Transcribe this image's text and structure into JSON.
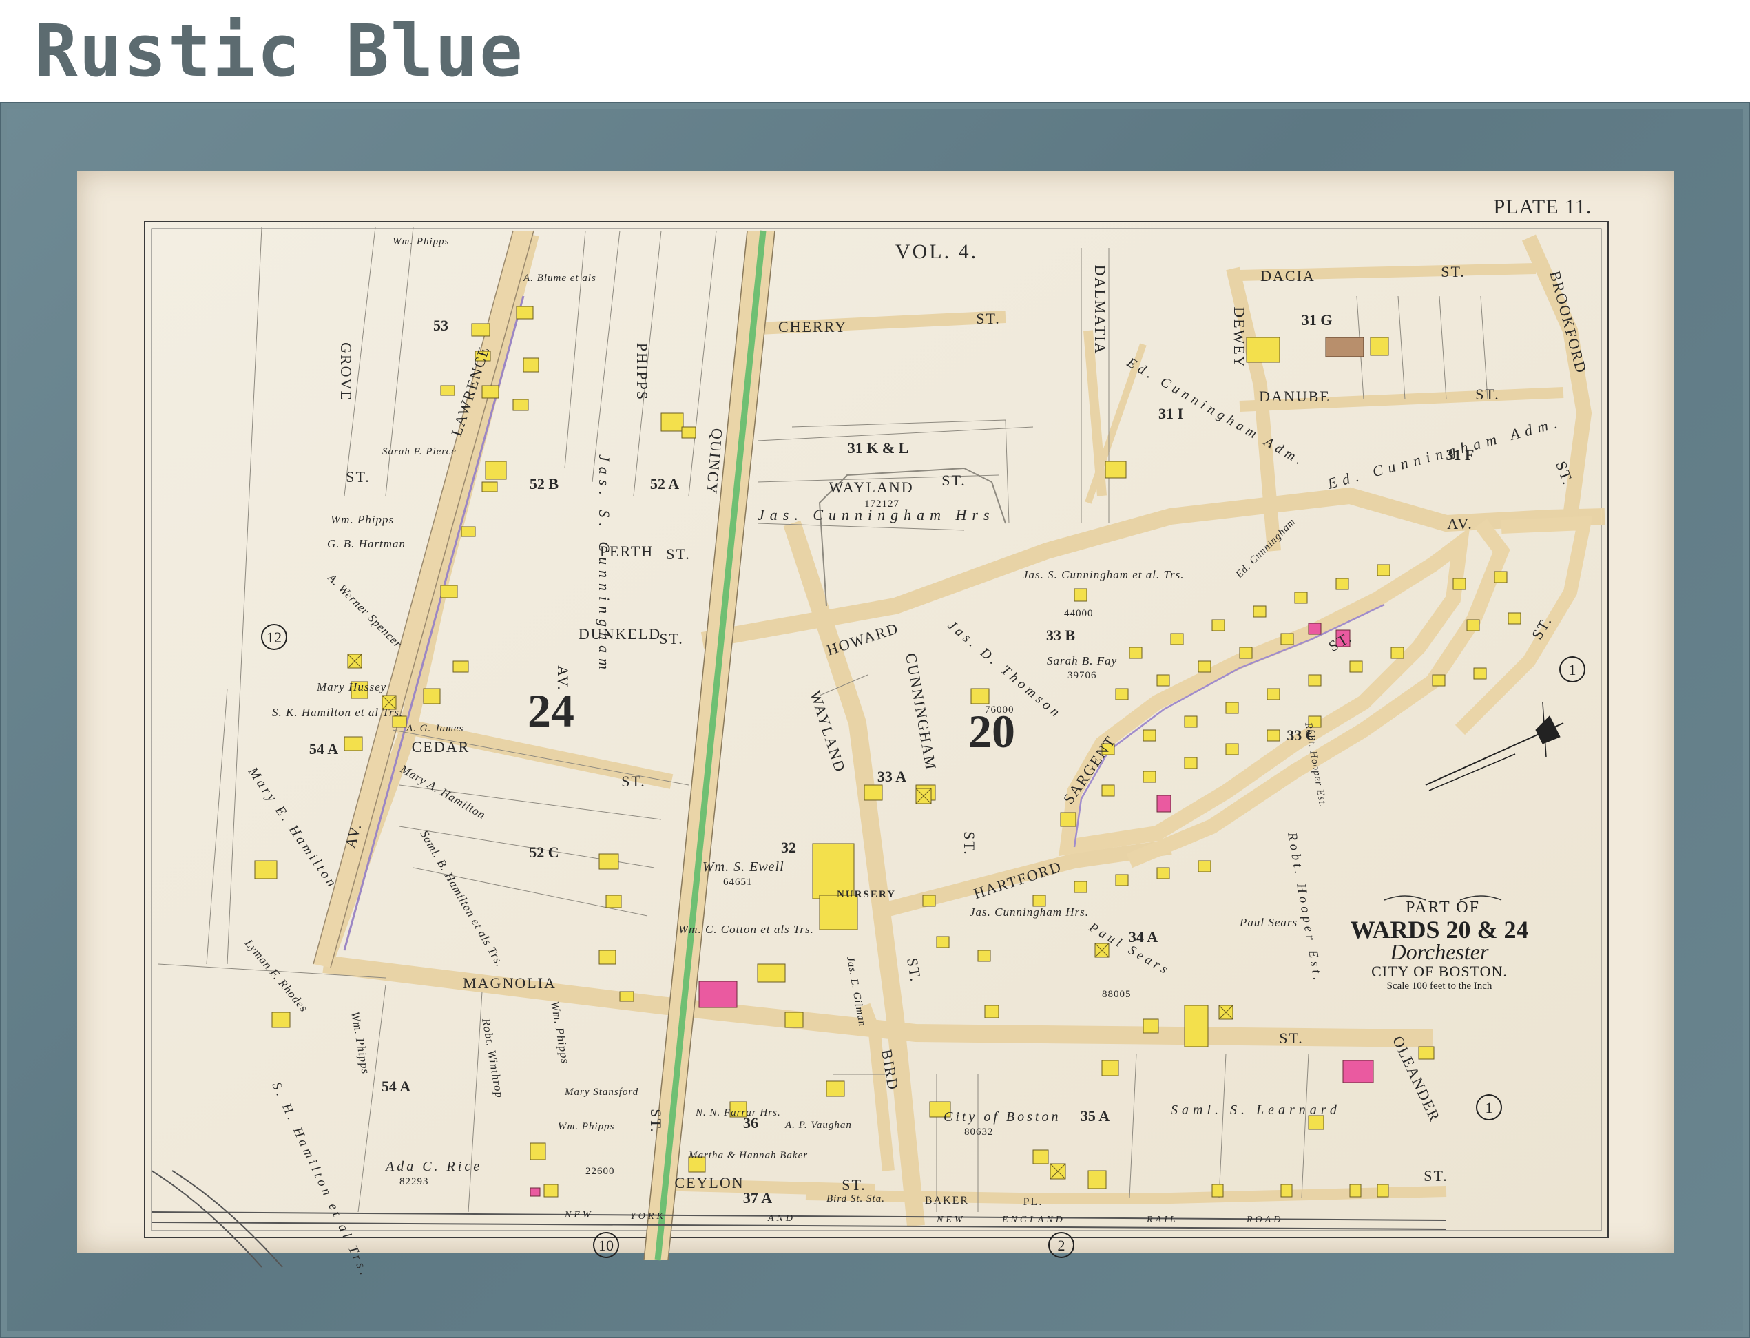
{
  "header": {
    "title": "Rustic Blue"
  },
  "map": {
    "plate": "PLATE 11.",
    "volume": "VOL. 4.",
    "cartouche": {
      "line1": "PART OF",
      "line2": "WARDS 20 & 24",
      "line3": "Dorchester",
      "line4": "CITY OF BOSTON.",
      "line5": "Scale 100 feet to the Inch"
    },
    "wards": {
      "left": "24",
      "right": "20"
    },
    "streets": {
      "lawrence": "LAWRENCE",
      "grove": "GROVE",
      "phipps": "PHIPPS",
      "quincy": "QUINCY",
      "cherry": "CHERRY",
      "cherry_st": "ST.",
      "dalmatia": "DALMATIA",
      "dewey": "DEWEY",
      "dacia": "DACIA",
      "dacia_st": "ST.",
      "brookford": "BROOKFORD",
      "danube": "DANUBE",
      "danube_st": "ST.",
      "wayland_top": "WAYLAND",
      "wayland_top_st": "ST.",
      "perth": "PERTH",
      "perth_st": "ST.",
      "howard": "HOWARD",
      "dunkeld": "DUNKELD",
      "dunkeld_st": "ST.",
      "cedar": "CEDAR",
      "cedar_st": "ST.",
      "wayland": "WAYLAND",
      "cunningham": "CUNNINGHAM",
      "sargent": "SARGENT",
      "sargent_st": "ST.",
      "hartford": "HARTFORD",
      "magnolia": "MAGNOLIA",
      "bird": "BIRD",
      "ceylon": "CEYLON",
      "ceylon_st": "ST.",
      "baker": "BAKER",
      "baker_pl": "PL.",
      "oleander": "OLEANDER",
      "oleander_st": "ST.",
      "av_left": "AV.",
      "av_mid": "AV.",
      "av_top": "AV.",
      "st_bottom": "ST.",
      "st_quincy": "ST.",
      "st_right": "ST.",
      "st_east": "ST.",
      "st_right2": "ST.",
      "grove_st": "ST.",
      "st_hartford": "ST.",
      "railroad": [
        "NEW",
        "YORK",
        "AND",
        "NEW",
        "ENGLAND",
        "RAIL",
        "ROAD"
      ]
    },
    "blocks": [
      "53",
      "52 B",
      "52 A",
      "31 K & L",
      "31 I",
      "31 F",
      "31 G",
      "33 B",
      "33 A",
      "32",
      "33 C",
      "52 C",
      "54 A",
      "54 A",
      "36",
      "35 A",
      "34 A",
      "37 A"
    ],
    "circles": [
      "12",
      "1",
      "1",
      "10",
      "2"
    ],
    "owners": [
      "Jas. Cunningham Hrs",
      "Jas. S. Cunningham",
      "Ed. Cunningham Adm.",
      "Ed. Cunningham Adm.",
      "Jas. S. Cunningham et al. Trs.",
      "Jas. D. Thomson",
      "Sarah B. Fay",
      "Wm. Phipps",
      "G. B. Hartman",
      "A. Werner Spencer",
      "Mary Hussey",
      "S. K. Hamilton et al Trs.",
      "Mary E. Hamilton",
      "Lyman F. Rhodes",
      "S. H. Hamilton et al Trs.",
      "Mary A. Hamilton",
      "Saml. B. Hamilton et als Trs.",
      "Wm. S. Ewell",
      "Wm. C. Cotton et als Trs.",
      "Wm. Phipps",
      "Robt. Winthrop",
      "Ada C. Rice",
      "Wm. Phipps",
      "Martha & Hannah Baker",
      "City of Boston",
      "Saml. S. Learnard",
      "Robt. Hooper Est.",
      "Paul Sears",
      "Paul Sears",
      "Jas. Cunningham Hrs.",
      "Sarah F. Pierce",
      "A. Blume et als",
      "Wm. Phipps",
      "Mary Stansford",
      "N. N. Farrar Hrs.",
      "A. P. Vaughan",
      "Jas. E. Gilman",
      "A. G. James",
      "Wm. Phipps",
      "Ed. Cunningham",
      "Bird St. Sta.",
      "NURSERY",
      "172127",
      "44000",
      "39706",
      "76000",
      "64651",
      "88005",
      "80632",
      "82293",
      "22600",
      "Robt. Hooper Est."
    ]
  }
}
